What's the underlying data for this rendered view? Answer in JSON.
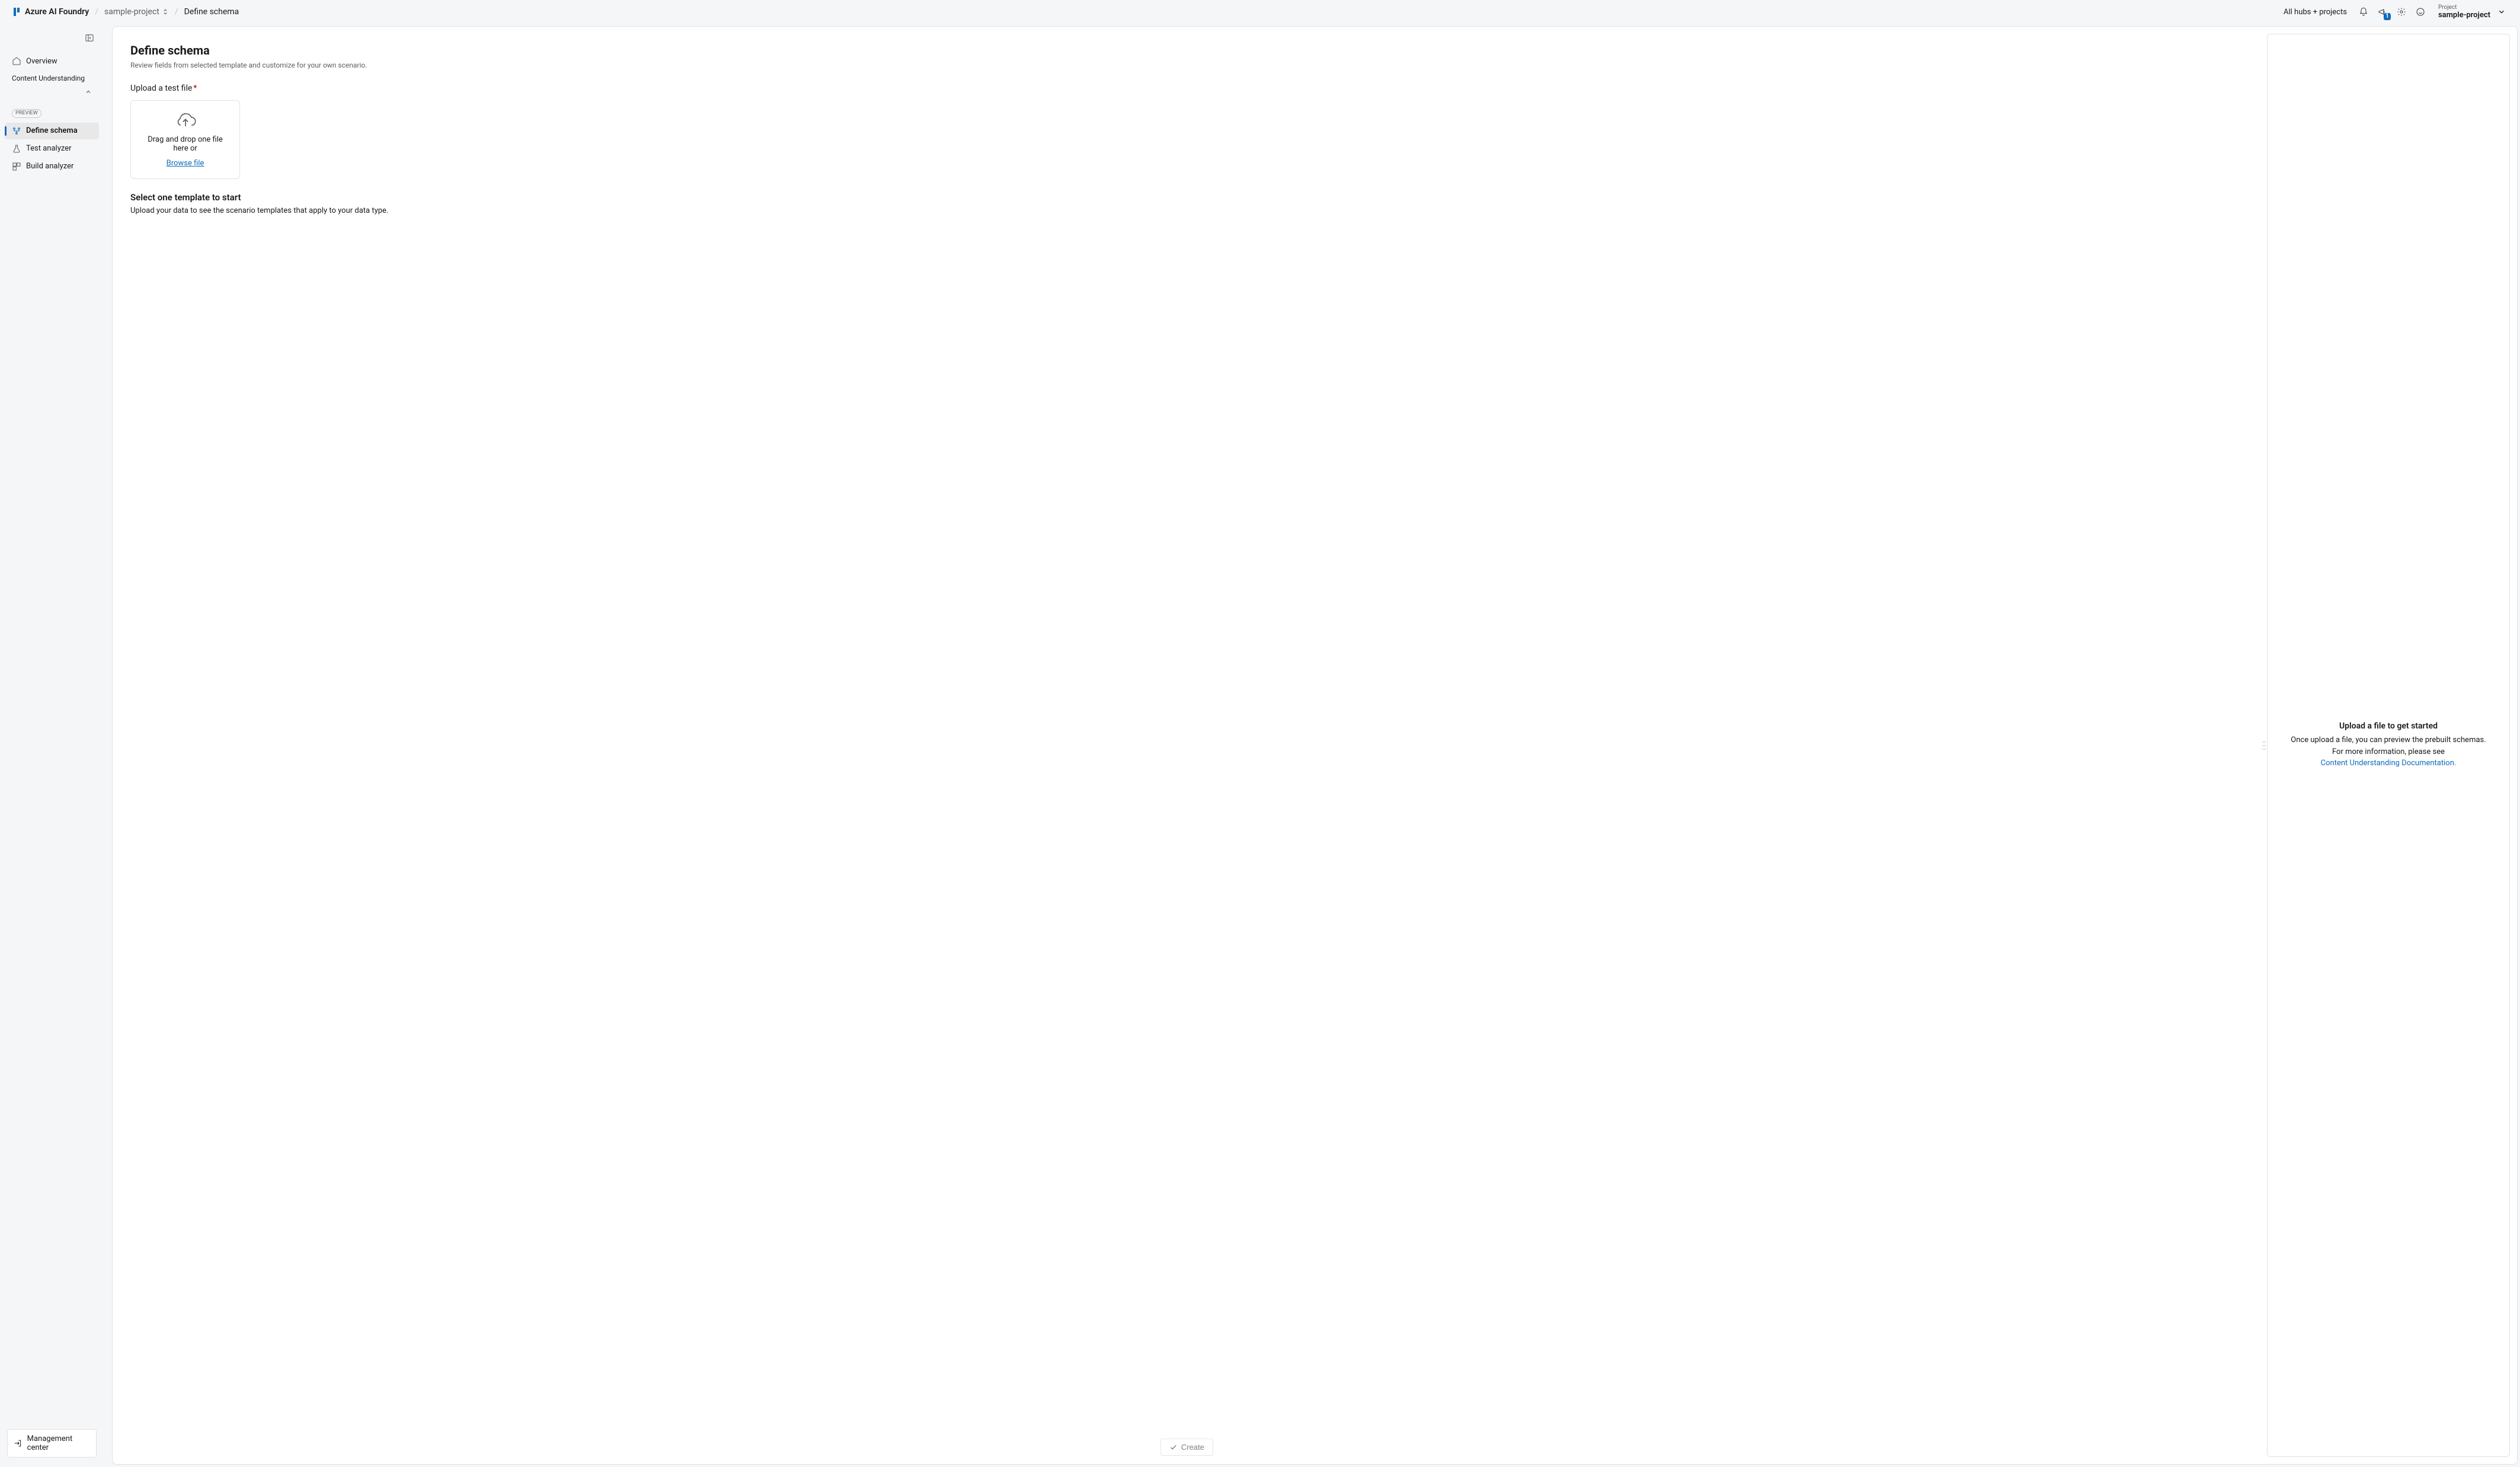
{
  "brand": "Azure AI Foundry",
  "breadcrumb": {
    "project": "sample-project",
    "current": "Define schema"
  },
  "header": {
    "hubs_link": "All hubs + projects",
    "notification_count": "1",
    "project_label": "Project",
    "project_value": "sample-project"
  },
  "sidebar": {
    "overview": "Overview",
    "section_title": "Content Understanding",
    "preview_tag": "PREVIEW",
    "items": {
      "define": "Define schema",
      "test": "Test analyzer",
      "build": "Build analyzer"
    },
    "mgmt": "Management center"
  },
  "page": {
    "title": "Define schema",
    "subtitle": "Review fields from selected template and customize for your own scenario.",
    "upload_label": "Upload a test file",
    "drop_text": "Drag and drop one file here or",
    "browse": "Browse file",
    "template_head": "Select one template to start",
    "template_sub": "Upload your data to see the scenario templates that apply to your data type.",
    "create": "Create"
  },
  "right_panel": {
    "head": "Upload a file to get started",
    "line1": "Once upload a file, you can preview the prebuilt schemas.",
    "line2": "For more information, please see",
    "doc_link": "Content Understanding Documentation."
  }
}
